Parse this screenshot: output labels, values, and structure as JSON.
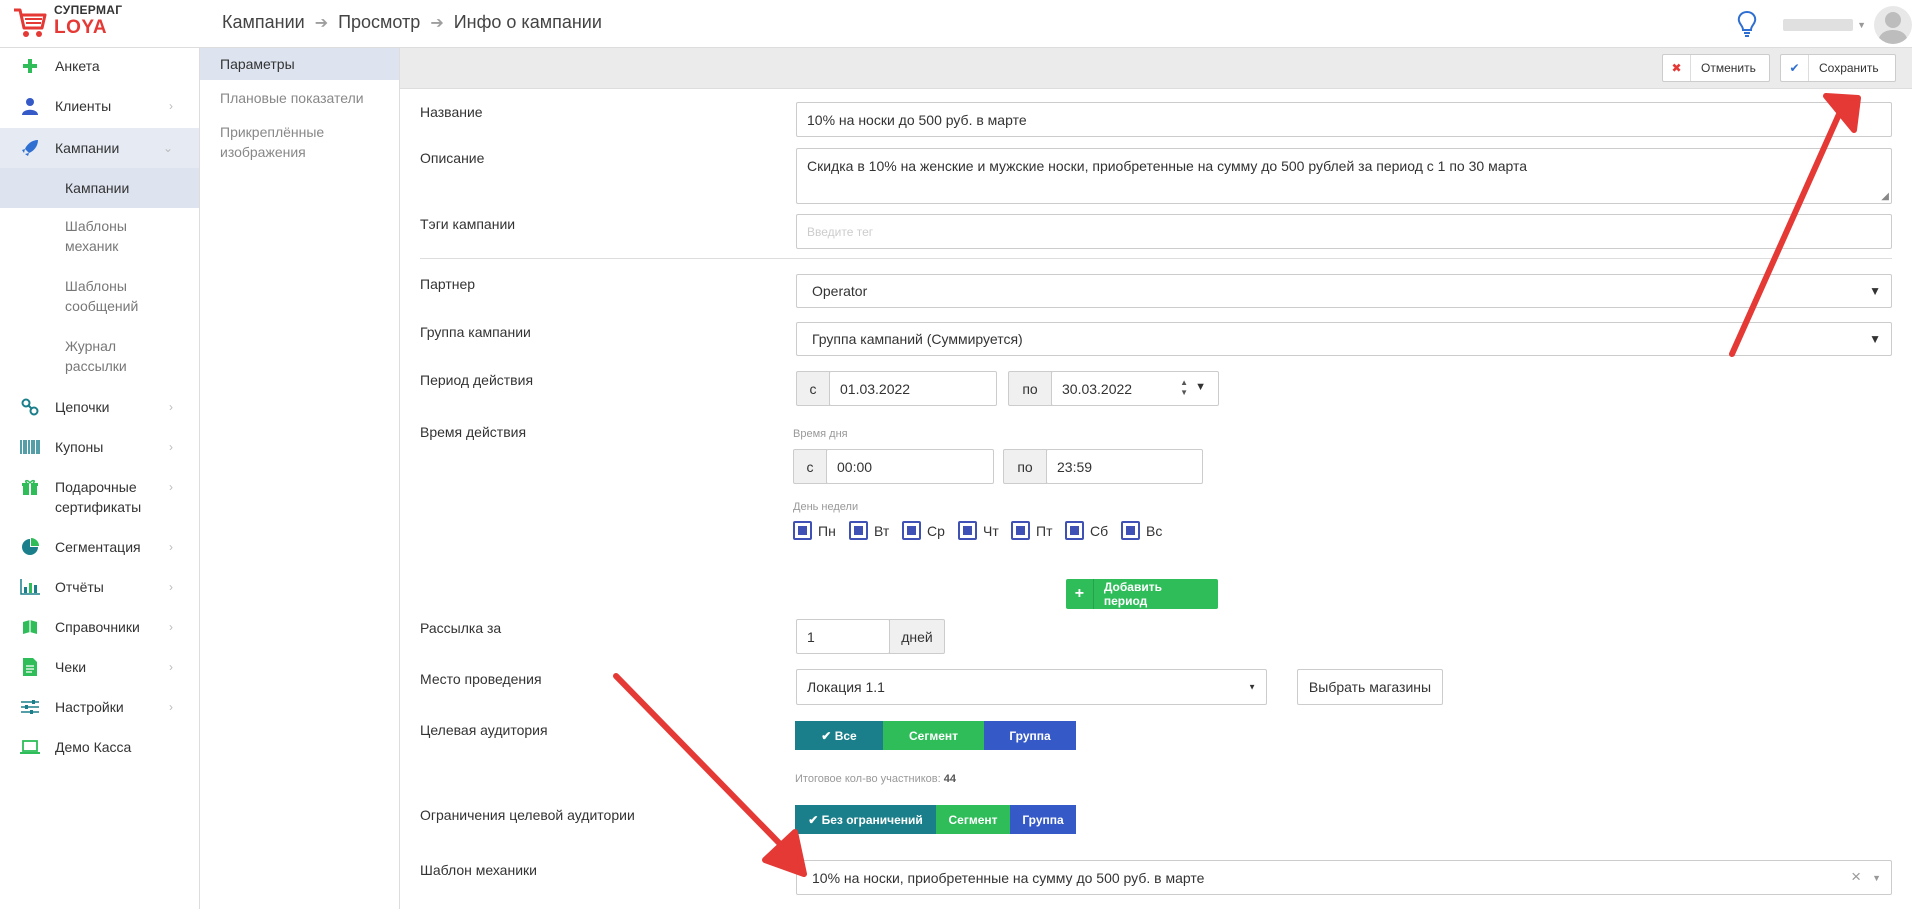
{
  "logo": {
    "line1": "СУПЕРМАГ",
    "line2": "LOYA"
  },
  "breadcrumb": [
    "Кампании",
    "Просмотр",
    "Инфо о кампании"
  ],
  "sidebar": {
    "items": [
      {
        "label": "Анкета",
        "icon": "plus-icon"
      },
      {
        "label": "Клиенты",
        "icon": "user-icon"
      },
      {
        "label": "Кампании",
        "icon": "rocket-icon"
      },
      {
        "label": "Цепочки",
        "icon": "chain-icon"
      },
      {
        "label": "Купоны",
        "icon": "barcode-icon"
      },
      {
        "label": "Подарочные сертификаты",
        "icon": "gift-icon"
      },
      {
        "label": "Сегментация",
        "icon": "pie-icon"
      },
      {
        "label": "Отчёты",
        "icon": "bar-chart-icon"
      },
      {
        "label": "Справочники",
        "icon": "book-icon"
      },
      {
        "label": "Чеки",
        "icon": "receipt-icon"
      },
      {
        "label": "Настройки",
        "icon": "sliders-icon"
      },
      {
        "label": "Демо Касса",
        "icon": "laptop-icon"
      }
    ],
    "sub": [
      "Кампании",
      "Шаблоны механик",
      "Шаблоны сообщений",
      "Журнал рассылки"
    ]
  },
  "col2": [
    "Параметры",
    "Плановые показатели",
    "Прикреплённые изображения"
  ],
  "toolbar": {
    "cancel": "Отменить",
    "save": "Сохранить"
  },
  "form": {
    "name_label": "Название",
    "name_value": "10% на носки до 500 руб. в марте",
    "desc_label": "Описание",
    "desc_value": "Скидка в 10% на женские и мужские носки, приобретенные на сумму до 500 рублей за период с 1 по 30 марта",
    "tags_label": "Тэги кампании",
    "tags_placeholder": "Введите тег",
    "partner_label": "Партнер",
    "partner_value": "Operator",
    "group_label": "Группа кампании",
    "group_value": "Группа кампаний (Суммируется)",
    "period_label": "Период действия",
    "period_from_prefix": "с",
    "period_from": "01.03.2022",
    "period_to_prefix": "по",
    "period_to": "30.03.2022",
    "time_label": "Время действия",
    "time_of_day": "Время дня",
    "time_from_prefix": "с",
    "time_from": "00:00",
    "time_to_prefix": "по",
    "time_to": "23:59",
    "weekday_caption": "День недели",
    "days": [
      "Пн",
      "Вт",
      "Ср",
      "Чт",
      "Пт",
      "Сб",
      "Вс"
    ],
    "add_period": "Добавить период",
    "mailing_label": "Рассылка за",
    "mailing_value": "1",
    "mailing_unit": "дней",
    "place_label": "Место проведения",
    "place_value": "Локация 1.1",
    "choose_shops": "Выбрать магазины",
    "audience_label": "Целевая аудитория",
    "audience_opts": [
      "Все",
      "Сегмент",
      "Группа"
    ],
    "participants_text": "Итоговое кол-во участников:",
    "participants_count": "44",
    "restrict_label": "Ограничения целевой аудитории",
    "restrict_opts": [
      "Без ограничений",
      "Сегмент",
      "Группа"
    ],
    "mechanic_label": "Шаблон механики",
    "mechanic_value": "10% на носки, приобретенные на сумму до 500 руб. в марте"
  },
  "colors": {
    "accent_green": "#2ebd59",
    "accent_teal": "#1a7f8a",
    "accent_blue": "#3559c7",
    "arrow_red": "#e53935"
  }
}
